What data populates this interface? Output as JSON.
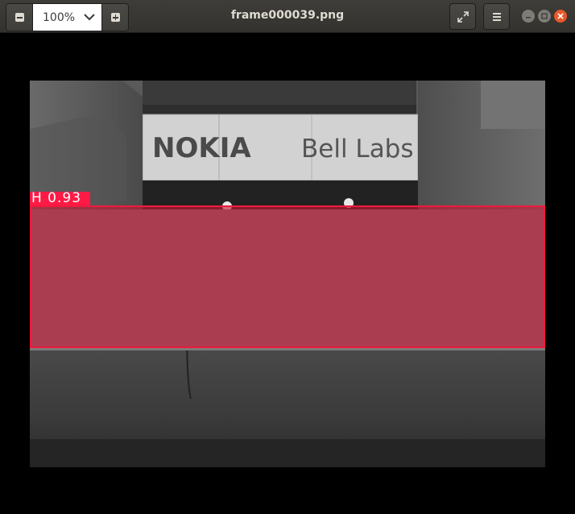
{
  "window": {
    "title": "frame000039.png"
  },
  "toolbar": {
    "zoom_out_icon": "zoom-out-icon",
    "zoom_value": "100%",
    "zoom_in_icon": "zoom-in-icon",
    "fullscreen_icon": "fullscreen-icon",
    "menu_icon": "hamburger-menu-icon"
  },
  "window_controls": {
    "minimize_icon": "minimize-icon",
    "maximize_icon": "maximize-icon",
    "close_icon": "close-icon"
  },
  "image": {
    "sign_text_brand": "NOKIA",
    "sign_text_sub": "Bell Labs",
    "detection": {
      "label": "H 0.93",
      "color": "#ef1a3c"
    }
  },
  "colors": {
    "headerbar": "#3c3b37",
    "close_button": "#e9592a",
    "detection_box": "#ef1a3c"
  }
}
